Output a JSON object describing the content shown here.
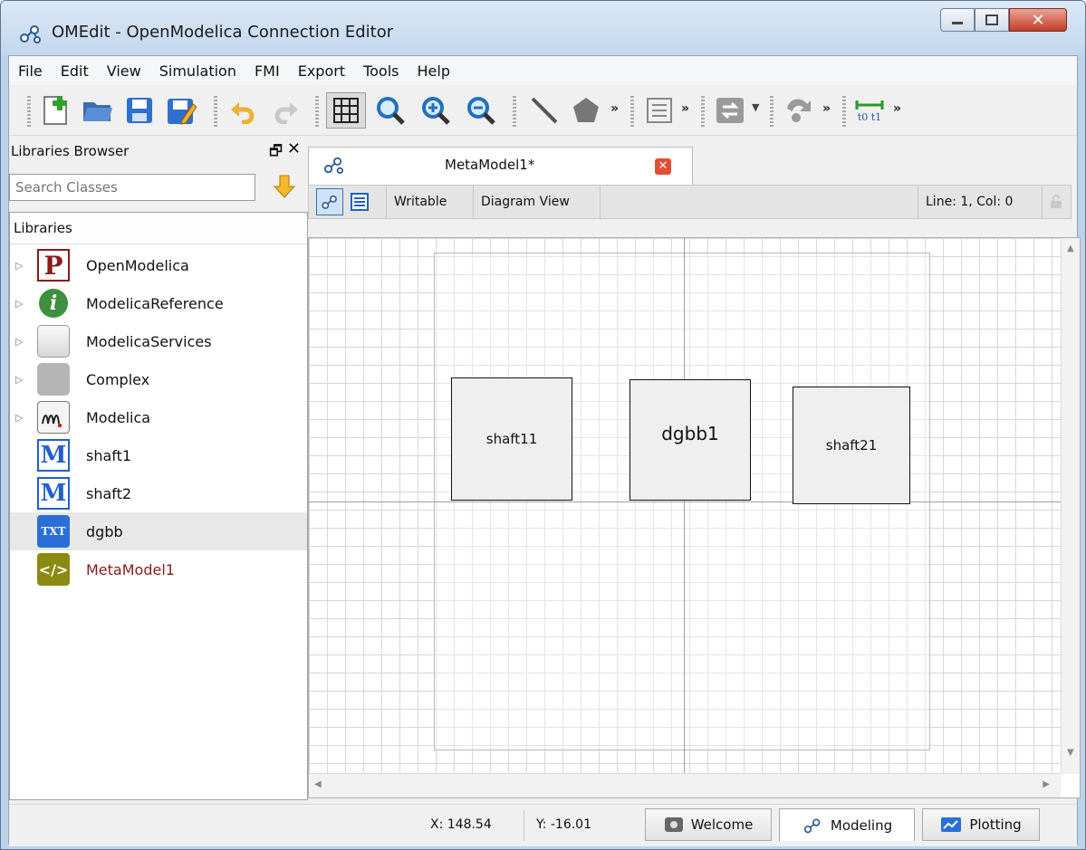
{
  "window": {
    "title": "OMEdit - OpenModelica Connection Editor",
    "controls": [
      "minimize",
      "maximize",
      "close"
    ]
  },
  "menubar": {
    "items": [
      "File",
      "Edit",
      "View",
      "Simulation",
      "FMI",
      "Export",
      "Tools",
      "Help"
    ]
  },
  "toolbar": {
    "icons": [
      "new-file-icon",
      "open-folder-icon",
      "save-icon",
      "save-as-icon",
      "undo-icon",
      "redo-icon",
      "grid-icon",
      "zoom-reset-icon",
      "zoom-in-icon",
      "zoom-out-icon",
      "line-icon",
      "polygon-icon",
      "align-icon",
      "connect-icon",
      "simulate-icon",
      "timeline-icon"
    ],
    "overflow": "»",
    "timeline_label": "t0 t1"
  },
  "libraries_browser": {
    "title": "Libraries Browser",
    "search_placeholder": "Search Classes",
    "tree_header": "Libraries",
    "items": [
      {
        "label": "OpenModelica",
        "icon": "package-p-icon",
        "expandable": true
      },
      {
        "label": "ModelicaReference",
        "icon": "info-icon",
        "expandable": true
      },
      {
        "label": "ModelicaServices",
        "icon": "gray-box-icon",
        "expandable": true
      },
      {
        "label": "Complex",
        "icon": "solid-gray-box-icon",
        "expandable": true
      },
      {
        "label": "Modelica",
        "icon": "modelica-icon",
        "expandable": true
      },
      {
        "label": "shaft1",
        "icon": "model-m-icon",
        "expandable": false
      },
      {
        "label": "shaft2",
        "icon": "model-m-icon",
        "expandable": false
      },
      {
        "label": "dgbb",
        "icon": "txt-icon",
        "expandable": false,
        "selected": true
      },
      {
        "label": "MetaModel1",
        "icon": "xml-icon",
        "expandable": false,
        "color": "#8b1a1a"
      }
    ]
  },
  "editor": {
    "tab_title": "MetaModel1*",
    "mode": "Writable",
    "view": "Diagram View",
    "cursor": "Line: 1, Col: 0",
    "components": [
      {
        "label": "shaft11"
      },
      {
        "label": "dgbb1"
      },
      {
        "label": "shaft21"
      }
    ]
  },
  "statusbar": {
    "x": "X: 148.54",
    "y": "Y: -16.01",
    "perspectives": [
      "Welcome",
      "Modeling",
      "Plotting"
    ],
    "active": "Modeling"
  }
}
